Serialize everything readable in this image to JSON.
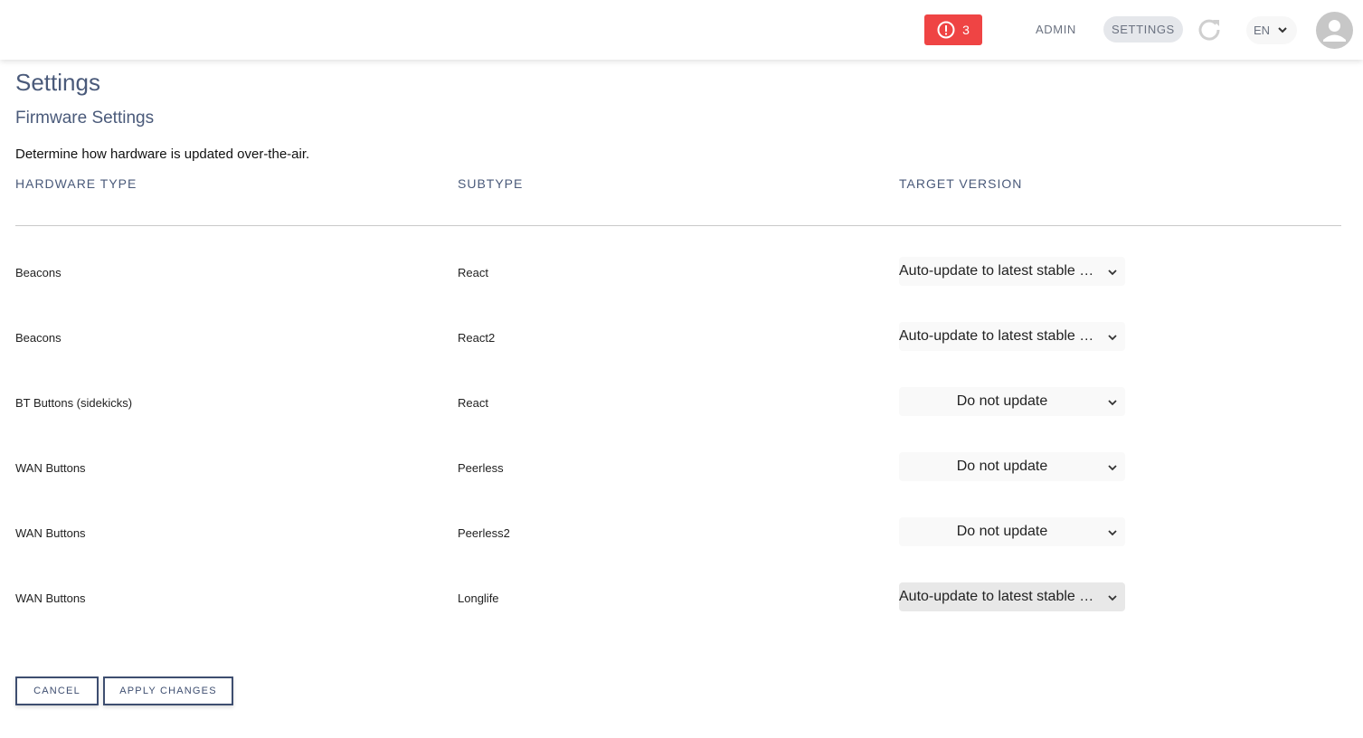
{
  "header": {
    "alert_count": "3",
    "nav": {
      "admin": "ADMIN",
      "settings": "SETTINGS"
    },
    "language": "EN"
  },
  "page": {
    "title": "Settings",
    "section_title": "Firmware Settings",
    "description": "Determine how hardware is updated over-the-air."
  },
  "table": {
    "columns": {
      "hardware_type": "HARDWARE TYPE",
      "subtype": "SUBTYPE",
      "target_version": "TARGET VERSION"
    },
    "rows": [
      {
        "hardware": "Beacons",
        "subtype": "React",
        "version": "Auto-update to latest stable version"
      },
      {
        "hardware": "Beacons",
        "subtype": "React2",
        "version": "Auto-update to latest stable version"
      },
      {
        "hardware": "BT Buttons (sidekicks)",
        "subtype": "React",
        "version": "Do not update"
      },
      {
        "hardware": "WAN Buttons",
        "subtype": "Peerless",
        "version": "Do not update"
      },
      {
        "hardware": "WAN Buttons",
        "subtype": "Peerless2",
        "version": "Do not update"
      },
      {
        "hardware": "WAN Buttons",
        "subtype": "Longlife",
        "version": "Auto-update to latest stable version"
      }
    ]
  },
  "actions": {
    "cancel": "CANCEL",
    "apply": "APPLY CHANGES"
  },
  "colors": {
    "alert": "#ef4444",
    "heading": "#4a5a7a",
    "button_border": "#3e4e70"
  }
}
